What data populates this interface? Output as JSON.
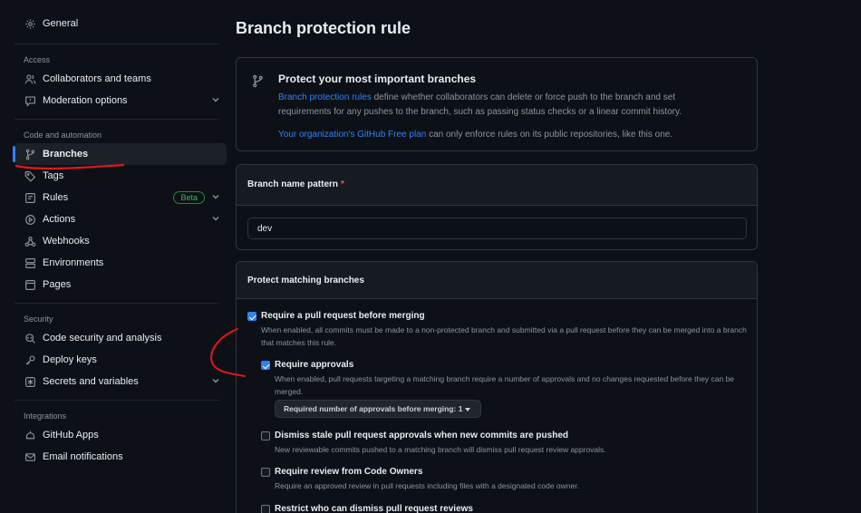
{
  "sidebar": {
    "general": {
      "label": "General",
      "icon": "gear-icon"
    },
    "sections": {
      "access": "Access",
      "code_automation": "Code and automation",
      "security": "Security",
      "integrations": "Integrations"
    },
    "access_items": [
      {
        "label": "Collaborators and teams",
        "icon": "person-icon"
      },
      {
        "label": "Moderation options",
        "icon": "report-icon",
        "expandable": true
      }
    ],
    "code_items": [
      {
        "label": "Branches",
        "icon": "git-branch-icon",
        "active": true
      },
      {
        "label": "Tags",
        "icon": "tag-icon"
      },
      {
        "label": "Rules",
        "icon": "rules-icon",
        "badge": "Beta",
        "expandable": true
      },
      {
        "label": "Actions",
        "icon": "play-icon",
        "expandable": true
      },
      {
        "label": "Webhooks",
        "icon": "webhook-icon"
      },
      {
        "label": "Environments",
        "icon": "server-icon"
      },
      {
        "label": "Pages",
        "icon": "browser-icon"
      }
    ],
    "security_items": [
      {
        "label": "Code security and analysis",
        "icon": "codescan-icon"
      },
      {
        "label": "Deploy keys",
        "icon": "key-icon"
      },
      {
        "label": "Secrets and variables",
        "icon": "asterisk-icon",
        "expandable": true
      }
    ],
    "integration_items": [
      {
        "label": "GitHub Apps",
        "icon": "apps-icon"
      },
      {
        "label": "Email notifications",
        "icon": "mail-icon"
      }
    ]
  },
  "main": {
    "title": "Branch protection rule",
    "intro": {
      "title": "Protect your most important branches",
      "link1": "Branch protection rules",
      "desc_rest": " define whether collaborators can delete or force push to the branch and set requirements for any pushes to the branch, such as passing status checks or a linear commit history.",
      "link2": "Your organization's GitHub Free plan",
      "plan_rest": " can only enforce rules on its public repositories, like this one."
    },
    "pattern": {
      "label": "Branch name pattern",
      "required_mark": "*",
      "value": "dev"
    },
    "protect": {
      "header": "Protect matching branches",
      "options": [
        {
          "title": "Require a pull request before merging",
          "desc": "When enabled, all commits must be made to a non-protected branch and submitted via a pull request before they can be merged into a branch that matches this rule.",
          "checked": true
        },
        {
          "title": "Require approvals",
          "desc": "When enabled, pull requests targeting a matching branch require a number of approvals and no changes requested before they can be merged.",
          "checked": true
        },
        {
          "title": "Dismiss stale pull request approvals when new commits are pushed",
          "desc": "New reviewable commits pushed to a matching branch will dismiss pull request review approvals.",
          "checked": false
        },
        {
          "title": "Require review from Code Owners",
          "desc": "Require an approved review in pull requests including files with a designated code owner.",
          "checked": false
        },
        {
          "title": "Restrict who can dismiss pull request reviews",
          "desc": "",
          "checked": false
        }
      ],
      "approvals_select": "Required number of approvals before merging: 1"
    }
  },
  "colors": {
    "background": "#0d1117",
    "accent": "#2f81f7",
    "annotation": "#e5171b",
    "beta_badge": "#3fb950"
  }
}
